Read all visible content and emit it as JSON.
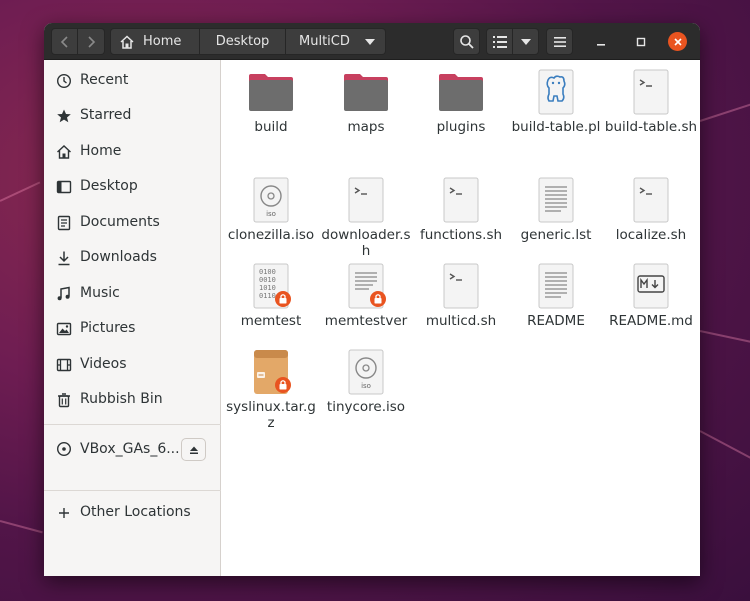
{
  "breadcrumb": {
    "home": "Home",
    "desktop": "Desktop",
    "current": "MultiCD"
  },
  "sidebar": {
    "items": [
      {
        "label": "Recent",
        "icon": "clock-icon"
      },
      {
        "label": "Starred",
        "icon": "star-icon"
      },
      {
        "label": "Home",
        "icon": "home-icon"
      },
      {
        "label": "Desktop",
        "icon": "desktop-icon"
      },
      {
        "label": "Documents",
        "icon": "document-icon"
      },
      {
        "label": "Downloads",
        "icon": "download-icon"
      },
      {
        "label": "Music",
        "icon": "music-icon"
      },
      {
        "label": "Pictures",
        "icon": "picture-icon"
      },
      {
        "label": "Videos",
        "icon": "video-icon"
      },
      {
        "label": "Rubbish Bin",
        "icon": "trash-icon"
      }
    ],
    "device": {
      "label": "VBox_GAs_6....",
      "icon": "disc-icon"
    },
    "other": {
      "label": "Other Locations",
      "icon": "plus-icon"
    }
  },
  "files": [
    {
      "name": "build",
      "type": "folder"
    },
    {
      "name": "maps",
      "type": "folder"
    },
    {
      "name": "plugins",
      "type": "folder"
    },
    {
      "name": "build-table.pl",
      "type": "perl"
    },
    {
      "name": "build-table.sh",
      "type": "script"
    },
    {
      "name": "clonezilla.iso",
      "type": "iso"
    },
    {
      "name": "downloader.sh",
      "type": "script"
    },
    {
      "name": "functions.sh",
      "type": "script"
    },
    {
      "name": "generic.lst",
      "type": "text"
    },
    {
      "name": "localize.sh",
      "type": "script"
    },
    {
      "name": "memtest",
      "type": "binary-locked"
    },
    {
      "name": "memtestver",
      "type": "text-locked"
    },
    {
      "name": "multicd.sh",
      "type": "script"
    },
    {
      "name": "README",
      "type": "text"
    },
    {
      "name": "README.md",
      "type": "markdown"
    },
    {
      "name": "syslinux.tar.gz",
      "type": "archive-locked"
    },
    {
      "name": "tinycore.iso",
      "type": "iso"
    }
  ],
  "colors": {
    "accent": "#e95420",
    "folder": "#6d6d6d",
    "folder_tab": "#c7405f"
  }
}
